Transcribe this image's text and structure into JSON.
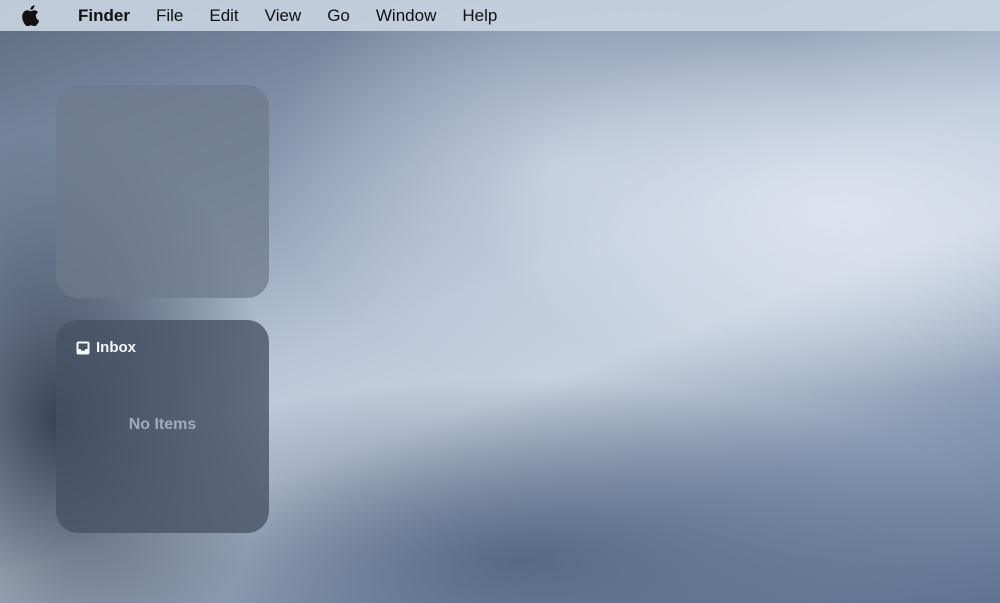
{
  "menubar": {
    "apple_icon": "apple-logo-icon",
    "app_name": "Finder",
    "items": [
      "File",
      "Edit",
      "View",
      "Go",
      "Window",
      "Help"
    ]
  },
  "widgets": {
    "inbox": {
      "icon": "inbox-tray-icon",
      "title": "Inbox",
      "empty_message": "No Items"
    }
  },
  "colors": {
    "menubar_bg": "#c8d2e0",
    "widget_bg": "#46525f",
    "widget_text": "#f4f6fa",
    "empty_text": "#a5b0c2"
  }
}
